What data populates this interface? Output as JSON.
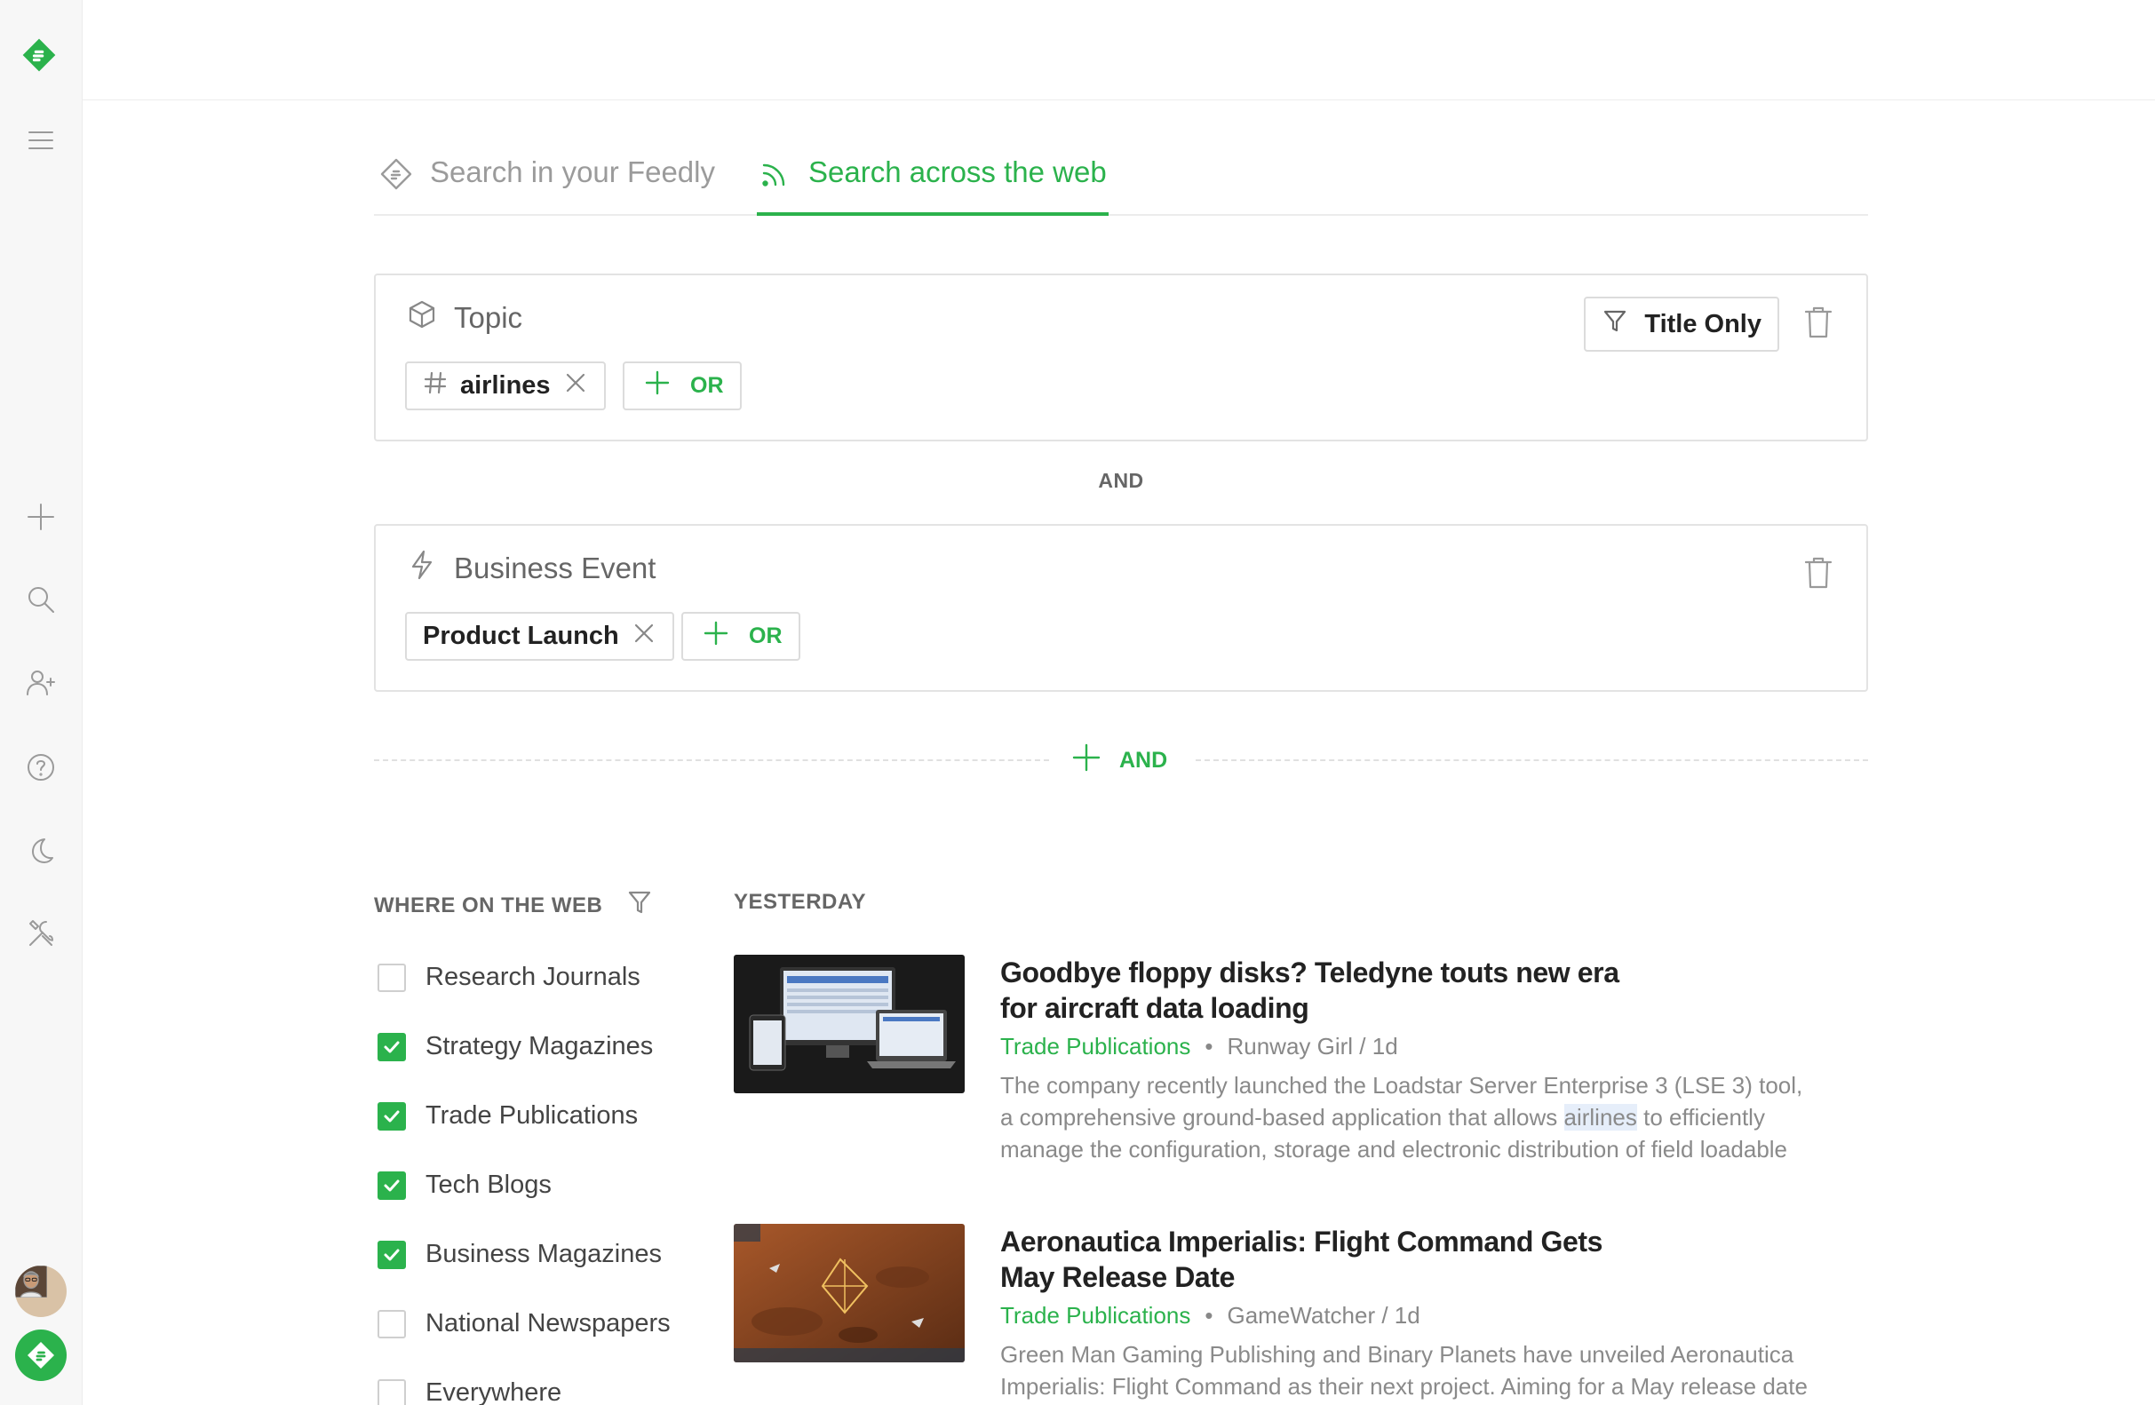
{
  "tabs": {
    "feedly": "Search in your Feedly",
    "web": "Search across the web"
  },
  "topic_card": {
    "title": "Topic",
    "chip": "airlines",
    "or_label": "OR",
    "title_only_label": "Title Only"
  },
  "and_label": "AND",
  "event_card": {
    "title": "Business Event",
    "chip": "Product Launch",
    "or_label": "OR"
  },
  "add_and_label": "AND",
  "filters": {
    "heading": "WHERE ON THE WEB",
    "items": [
      {
        "label": "Research Journals",
        "checked": false
      },
      {
        "label": "Strategy Magazines",
        "checked": true
      },
      {
        "label": "Trade Publications",
        "checked": true
      },
      {
        "label": "Tech Blogs",
        "checked": true
      },
      {
        "label": "Business Magazines",
        "checked": true
      },
      {
        "label": "National Newspapers",
        "checked": false
      },
      {
        "label": "Everywhere",
        "checked": false
      }
    ]
  },
  "results": {
    "section_label": "YESTERDAY",
    "articles": [
      {
        "title_line1": "Goodbye floppy disks? Teledyne touts new era",
        "title_line2": "for aircraft data loading",
        "source": "Trade Publications",
        "meta": "Runway Girl / 1d",
        "snippet_line1": "The company recently launched the Loadstar Server Enterprise 3 (LSE 3) tool,",
        "snippet_line2_pre": "a comprehensive ground-based application that allows",
        "snippet_highlight": "airlines",
        "snippet_line2_post": "to efficiently",
        "snippet_line3": "manage the configuration, storage and electronic distribution of field loadable"
      },
      {
        "title_line1": "Aeronautica Imperialis: Flight Command Gets",
        "title_line2": "May Release Date",
        "source": "Trade Publications",
        "meta": "GameWatcher / 1d",
        "snippet_line1": "Green Man Gaming Publishing and Binary Planets have unveiled Aeronautica",
        "snippet_line2": "Imperialis: Flight Command as their next project. Aiming for a May release date"
      }
    ]
  },
  "colors": {
    "accent": "#2bb24c",
    "text": "#222222",
    "muted": "#8a8a8a",
    "border": "#e3e3e3"
  },
  "icons": {
    "rail": [
      "feedly-logo-icon",
      "menu-icon",
      "plus-icon",
      "search-icon",
      "add-user-icon",
      "help-icon",
      "moon-icon",
      "tools-icon"
    ],
    "tab_feedly": "feedly-outline-icon",
    "tab_web": "rss-icon",
    "topic": "cube-icon",
    "event": "lightning-icon",
    "hash": "hash-icon",
    "remove": "close-icon",
    "filter": "funnel-icon",
    "delete": "trash-icon"
  }
}
